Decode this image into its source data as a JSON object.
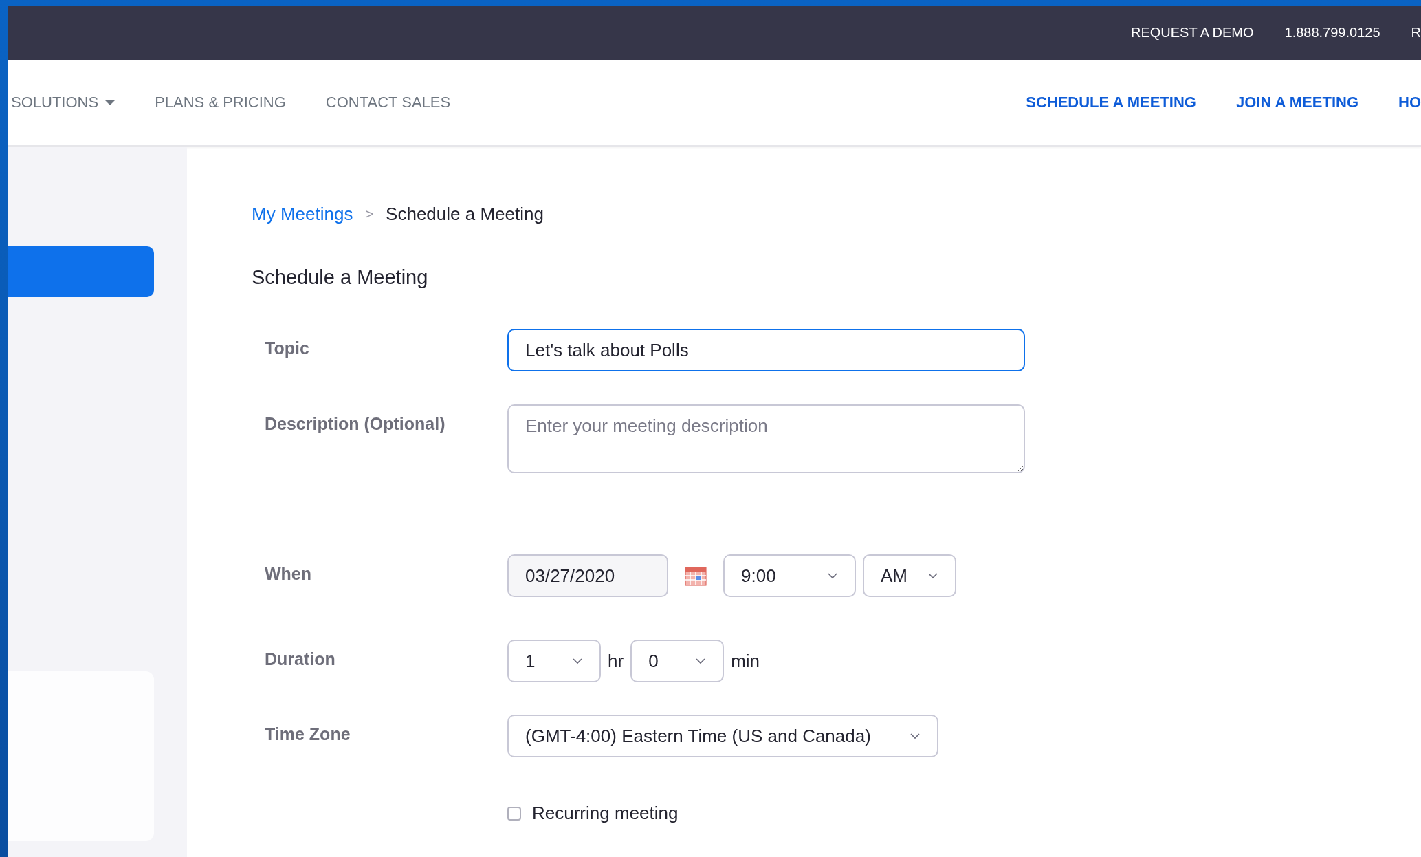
{
  "top_bar": {
    "links": [
      "REQUEST A DEMO",
      "1.888.799.0125",
      "R"
    ]
  },
  "nav": {
    "left": [
      {
        "label": "SOLUTIONS",
        "dropdown": true
      },
      {
        "label": "PLANS & PRICING",
        "dropdown": false
      },
      {
        "label": "CONTACT SALES",
        "dropdown": false
      }
    ],
    "right": [
      "SCHEDULE A MEETING",
      "JOIN A MEETING",
      "HO"
    ]
  },
  "sidebar": {
    "items": [
      {
        "selected": true
      }
    ]
  },
  "breadcrumb": {
    "link": "My Meetings",
    "separator": ">",
    "current": "Schedule a Meeting"
  },
  "title": "Schedule a Meeting",
  "form": {
    "topic": {
      "label": "Topic",
      "value": "Let's talk about Polls"
    },
    "description": {
      "label": "Description (Optional)",
      "placeholder": "Enter your meeting description"
    },
    "when": {
      "label": "When",
      "date": "03/27/2020",
      "time": "9:00",
      "ampm": "AM"
    },
    "duration": {
      "label": "Duration",
      "hours": "1",
      "hours_unit": "hr",
      "minutes": "0",
      "minutes_unit": "min"
    },
    "time_zone": {
      "label": "Time Zone",
      "value": "(GMT-4:00) Eastern Time (US and Canada)"
    },
    "recurring": {
      "label": "Recurring meeting",
      "checked": false
    }
  }
}
